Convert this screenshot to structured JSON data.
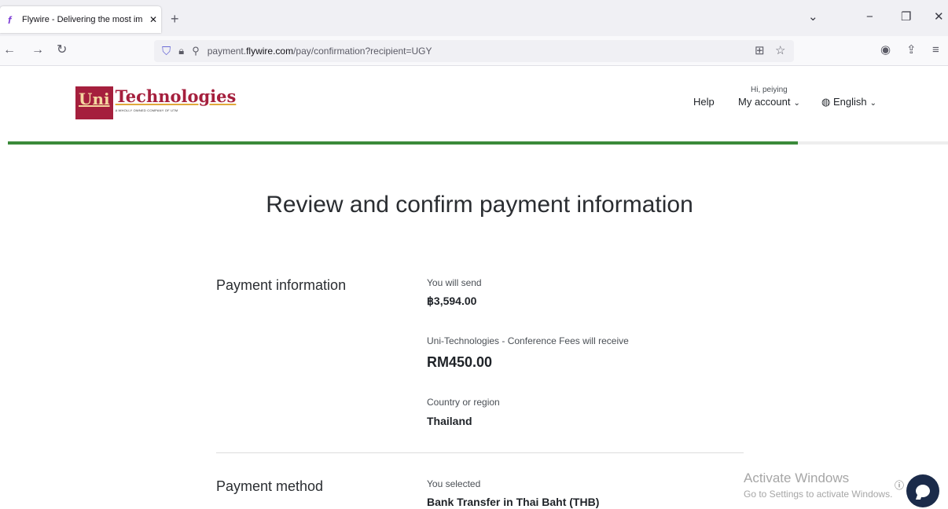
{
  "browser": {
    "tab_title": "Flywire - Delivering the most im",
    "tab_favicon": "flywire-favicon-icon",
    "new_tab_symbol": "+",
    "url_prefix": "payment.",
    "url_domain": "flywire.com",
    "url_path": "/pay/confirmation?recipient=UGY"
  },
  "header": {
    "logo_uni": "Uni",
    "logo_tech": "Technologies",
    "logo_subtitle": "A WHOLLY OWNED COMPANY OF UTM",
    "help": "Help",
    "greeting": "Hi, peiying",
    "account": "My account",
    "language": "English"
  },
  "progress": {
    "fraction": 0.84,
    "color": "#3b8a3a"
  },
  "page_title": "Review and confirm payment information",
  "payment_information": {
    "section_label": "Payment information",
    "send_label": "You will send",
    "send_value": "฿3,594.00",
    "receive_label": "Uni-Technologies - Conference Fees will receive",
    "receive_value": "RM450.00",
    "country_label": "Country or region",
    "country_value": "Thailand"
  },
  "payment_method": {
    "section_label": "Payment method",
    "selected_label": "You selected",
    "selected_value": "Bank Transfer in Thai Baht (THB)"
  },
  "overlay": {
    "watermark_title": "Activate Windows",
    "watermark_subtitle": "Go to Settings to activate Windows."
  },
  "colors": {
    "brand": "#a51f3d",
    "progress": "#3b8a3a",
    "chat": "#1b2b4a"
  }
}
